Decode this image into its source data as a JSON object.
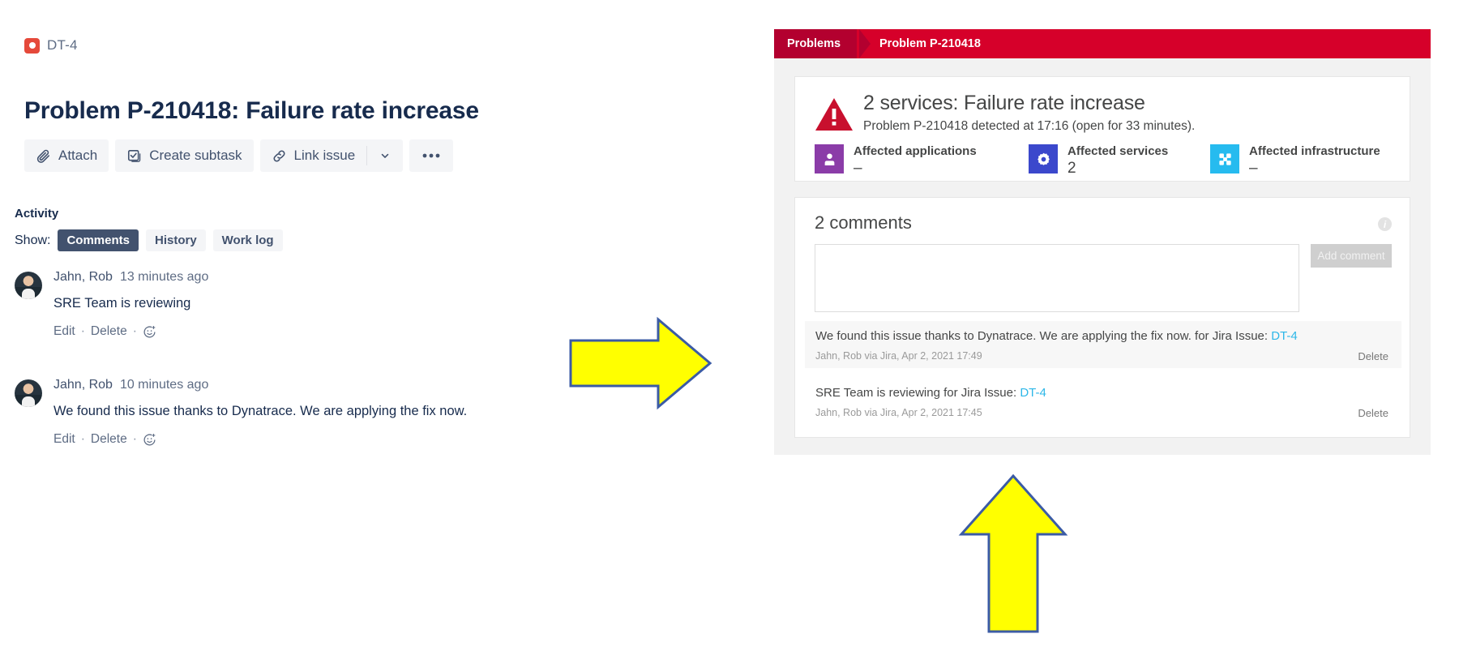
{
  "jira": {
    "issue_key": "DT-4",
    "issue_key_icon": "story-icon",
    "title": "Problem P-210418: Failure rate increase",
    "actions": {
      "attach": "Attach",
      "create_subtask": "Create subtask",
      "link_issue": "Link issue",
      "caret": "⌄",
      "more": "•••"
    },
    "activity_label": "Activity",
    "show_label": "Show:",
    "tabs": [
      {
        "label": "Comments",
        "active": true
      },
      {
        "label": "History",
        "active": false
      },
      {
        "label": "Work log",
        "active": false
      }
    ],
    "comments": [
      {
        "author": "Jahn, Rob",
        "time": "13 minutes ago",
        "body": "SRE Team is reviewing",
        "edit": "Edit",
        "delete": "Delete",
        "separator": "·"
      },
      {
        "author": "Jahn, Rob",
        "time": "10 minutes ago",
        "body": "We found this issue thanks to Dynatrace. We are applying the fix now.",
        "edit": "Edit",
        "delete": "Delete",
        "separator": "·"
      }
    ]
  },
  "dynatrace": {
    "breadcrumb": {
      "root": "Problems",
      "current": "Problem P-210418"
    },
    "problem": {
      "title": "2 services: Failure rate increase",
      "subtitle": "Problem P-210418 detected at 17:16 (open for 33 minutes).",
      "stats": [
        {
          "label": "Affected applications",
          "value": "–",
          "icon": "user-icon",
          "color": "#8B3CA8"
        },
        {
          "label": "Affected services",
          "value": "2",
          "icon": "gear-icon",
          "color": "#3B48CC"
        },
        {
          "label": "Affected infrastructure",
          "value": "–",
          "icon": "hosts-icon",
          "color": "#26BBEF"
        }
      ]
    },
    "comments_panel": {
      "heading": "2 comments",
      "info_icon": "info-icon",
      "textarea_value": "",
      "textarea_placeholder": "",
      "add_button": "Add comment",
      "items": [
        {
          "text_before_link": "We found this issue thanks to Dynatrace. We are applying the fix now. for Jira Issue: ",
          "link": "DT-4",
          "meta": "Jahn, Rob via Jira, Apr 2, 2021 17:49",
          "delete": "Delete"
        },
        {
          "text_before_link": "SRE Team is reviewing for Jira Issue: ",
          "link": "DT-4",
          "meta": "Jahn, Rob via Jira, Apr 2, 2021 17:45",
          "delete": "Delete"
        }
      ]
    }
  },
  "annotations": {
    "arrow_right": {
      "name": "flow-arrow-right",
      "fill": "#FFFF00",
      "stroke": "#3B5BA5"
    },
    "arrow_up": {
      "name": "callout-arrow-up",
      "fill": "#FFFF00",
      "stroke": "#3B5BA5"
    }
  }
}
